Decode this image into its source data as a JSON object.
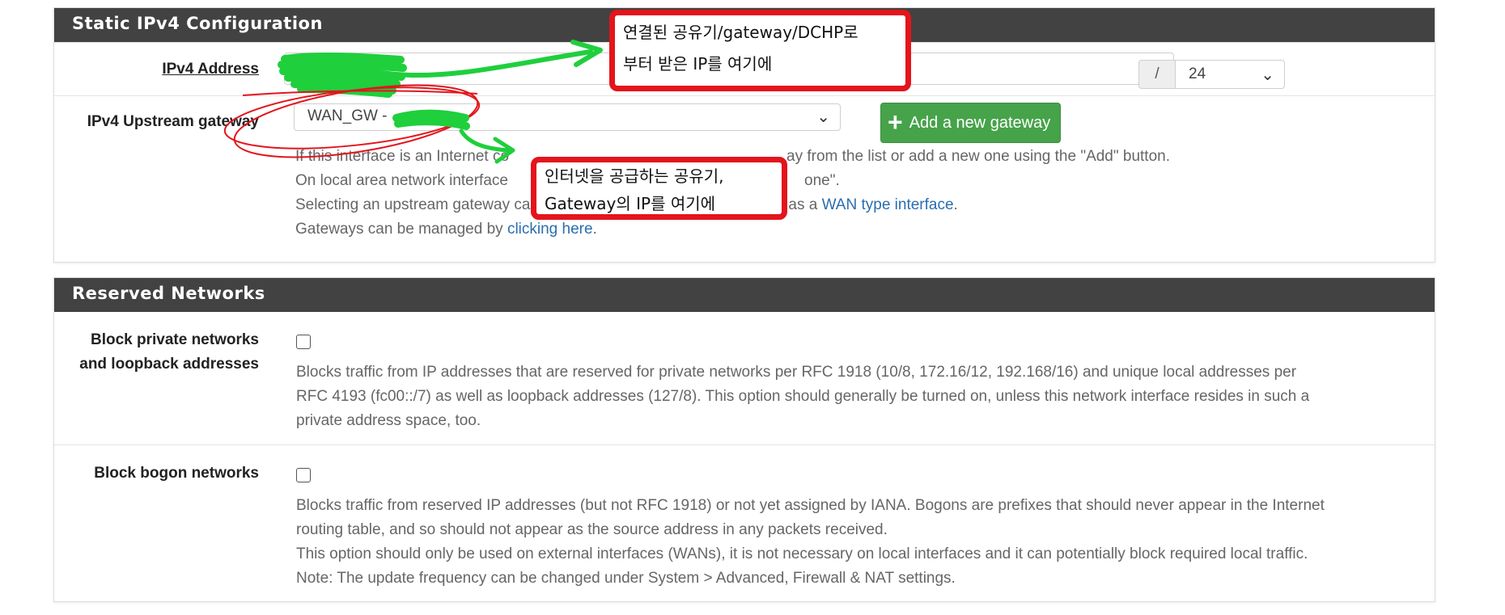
{
  "static_ipv4": {
    "heading": "Static IPv4 Configuration",
    "ipv4_address_label": "IPv4 Address",
    "subnet_separator": "/",
    "subnet_mask": "24",
    "upstream_gateway_label": "IPv4 Upstream gateway",
    "upstream_gateway_value": "WAN_GW - ",
    "add_gateway_label": "Add a new gateway",
    "help": {
      "line1_start": "If this interface is an Internet co",
      "line1_end": "ay from the list or add a new one using the \"Add\" button.",
      "line2_start": "On local area network interface",
      "line2_end": "one\".",
      "line3_start": "Selecting an upstream gateway causes the firewall to treat this interface as a ",
      "line3_link": "WAN type interface",
      "line3_end": ".",
      "line4_start": "Gateways can be managed by ",
      "line4_link": "clicking here",
      "line4_end": "."
    }
  },
  "reserved_networks": {
    "heading": "Reserved Networks",
    "block_private_label_line1": "Block private networks",
    "block_private_label_line2": "and loopback addresses",
    "block_private_help_1": "Blocks traffic from IP addresses that are reserved for private networks per RFC 1918 (10/8, 172.16/12, 192.168/16) and unique local addresses per",
    "block_private_help_2": "RFC 4193 (fc00::/7) as well as loopback addresses (127/8). This option should generally be turned on, unless this network interface resides in such a",
    "block_private_help_3": "private address space, too.",
    "block_bogon_label": "Block bogon networks",
    "block_bogon_help_1": "Blocks traffic from reserved IP addresses (but not RFC 1918) or not yet assigned by IANA. Bogons are prefixes that should never appear in the Internet",
    "block_bogon_help_2": "routing table, and so should not appear as the source address in any packets received.",
    "block_bogon_help_3": "This option should only be used on external interfaces (WANs), it is not necessary on local interfaces and it can potentially block required local traffic.",
    "block_bogon_help_4": "Note: The update frequency can be changed under System > Advanced, Firewall & NAT settings.",
    "block_private_checked": false,
    "block_bogon_checked": false
  },
  "annotations": {
    "note1_line1": "연결된 공유기/gateway/DCHP로",
    "note1_line2": "부터 받은 IP를 여기에",
    "note2_line1": "인터넷을 공급하는 공유기,",
    "note2_line2": "Gateway의 IP를 여기에"
  },
  "colors": {
    "heading_bg": "#424242",
    "success": "#46a34a",
    "link": "#2a6db0",
    "annotation_red": "#e4141c",
    "annotation_green": "#1fcf3c"
  },
  "icons": {
    "chevron": "chevron-down-icon",
    "plus": "plus-icon"
  }
}
